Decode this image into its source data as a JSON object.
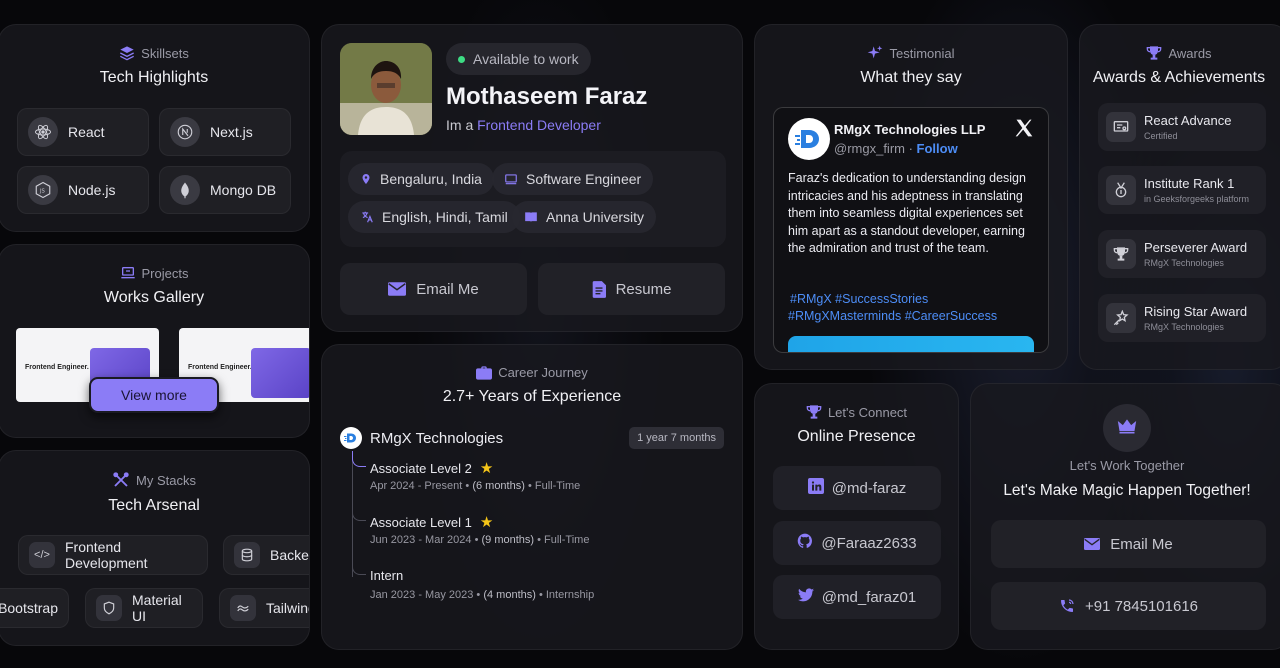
{
  "skillsets": {
    "sub": "Skillsets",
    "title": "Tech Highlights",
    "items": [
      {
        "label": "React"
      },
      {
        "label": "Next.js"
      },
      {
        "label": "Node.js"
      },
      {
        "label": "Mongo DB"
      }
    ]
  },
  "projects": {
    "sub": "Projects",
    "title": "Works Gallery",
    "thumb_text": "Frontend Engineer.",
    "view_more": "View more"
  },
  "stacks": {
    "sub": "My Stacks",
    "title": "Tech Arsenal",
    "row1": [
      "Frontend Development",
      "Backend"
    ],
    "row2": [
      "Bootstrap",
      "Material UI",
      "Tailwind"
    ]
  },
  "profile": {
    "status": "Available to work",
    "name": "Mothaseem Faraz",
    "tagline_prefix": "Im a",
    "tagline_role": "Frontend Developer",
    "location": "Bengaluru, India",
    "job": "Software Engineer",
    "languages": "English, Hindi, Tamil",
    "university": "Anna University",
    "email_btn": "Email Me",
    "resume_btn": "Resume"
  },
  "career": {
    "sub": "Career Journey",
    "title": "2.7+ Years of Experience",
    "company": "RMgX Technologies",
    "duration": "1 year 7 months",
    "roles": [
      {
        "title": "Associate Level 2",
        "dates": "Apr 2024 - Present",
        "length": "(6 months)",
        "type": "Full-Time"
      },
      {
        "title": "Associate Level 1",
        "dates": "Jun 2023 - Mar 2024",
        "length": "(9 months)",
        "type": "Full-Time"
      },
      {
        "title": "Intern",
        "dates": "Jan 2023 - May 2023",
        "length": "(4 months)",
        "type": "Internship"
      }
    ]
  },
  "testimonial": {
    "sub": "Testimonial",
    "title": "What they say",
    "author": "RMgX Technologies LLP",
    "handle": "@rmgx_firm",
    "follow": "Follow",
    "body": "Faraz's dedication to understanding design intricacies and his adeptness in translating them into seamless digital experiences set him apart as a standout developer, earning the admiration and trust of the team.",
    "tags1": "#RMgX #SuccessStories",
    "tags2": "#RMgXMasterminds #CareerSuccess"
  },
  "awards": {
    "sub": "Awards",
    "title": "Awards & Achievements",
    "items": [
      {
        "title": "React Advance",
        "sub": "Certified"
      },
      {
        "title": "Institute Rank 1",
        "sub": "in Geeksforgeeks platform"
      },
      {
        "title": "Perseverer Award",
        "sub": "RMgX Technologies"
      },
      {
        "title": "Rising Star Award",
        "sub": "RMgX Technologies"
      }
    ]
  },
  "connect": {
    "sub": "Let's Connect",
    "title": "Online Presence",
    "linkedin": "@md-faraz",
    "github": "@Faraaz2633",
    "twitter": "@md_faraz01"
  },
  "together": {
    "sub": "Let's Work Together",
    "title": "Let's Make Magic Happen Together!",
    "email_btn": "Email Me",
    "phone": "+91 7845101616"
  },
  "colors": {
    "accent": "#8b7cf6",
    "link": "#4d8df6",
    "status": "#3ddc84"
  }
}
